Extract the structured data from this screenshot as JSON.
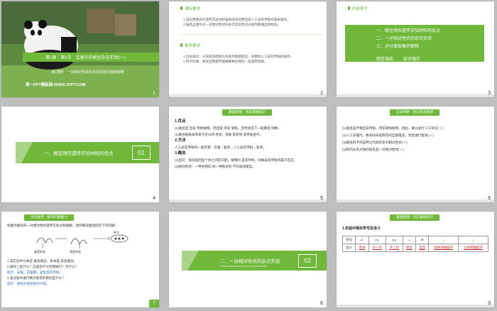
{
  "slides": [
    {
      "num": "1",
      "title": "第1章　第1节　孟德尔的豌豆杂交实验(一)",
      "subtitle": "第1课时　一对相对性状的杂交实验过程和解释",
      "footer": "第一PPT模板网-WWW.1PPT.COM"
    },
    {
      "num": "2",
      "section1": "课标要求",
      "items1": [
        "1.说出用豌豆作遗传实验材料容易成功的原因及人工异花传粉的基本操作。",
        "2.描述孟德尔对一对相对性状的杂交实验及对分离现象做出的假说。"
      ],
      "section2": "素养要求",
      "items2": [
        "1.生命观念：认知花的结构与生殖功能相适应，并模拟人工异花传粉的操作。",
        "2.科学思维：尝试运用遗传图解解释生物的一些遗传现象。"
      ]
    },
    {
      "num": "3",
      "header": "内容索引",
      "menu": [
        "一、豌豆用作遗传实验材料的优点",
        "二、一对相对性状的杂交实验",
        "三、对分离现象的解释"
      ],
      "extra": [
        "随堂演练",
        "知识落实"
      ]
    },
    {
      "num": "4",
      "title": "一、豌豆用作遗传实验材料的优点",
      "badge": "01"
    },
    {
      "num": "5",
      "tag": "基础梳理 · 夯实基础知识",
      "lines": [
        "1.优点",
        "(1)豌豆是 自花 传粉植物，而且是 闭花 受粉。自然状态下一般都是 纯种。",
        "(2)豌豆植株具有易于区分的 性状，且能 稳定地 遗传给后代。",
        "2.方法",
        "人工异花传粉的一般步骤：去雄→套袋→人工异花传粉→套袋。",
        "3.概念",
        "(1)自交：指同基因型个体之间的交配，植物的 自花传粉，同株异花传粉均属于自交。",
        "(2)相对性状：一种生物的 同一种性状的 不同表现类型。"
      ]
    },
    {
      "num": "6",
      "tag": "正误判断 · 矫正易混易错",
      "lines": [
        "(1)豌豆是严格自花传粉、闭花受粉植物，因此，难以进行人工杂交( × )",
        "(2)人工去雄时，要去除未成熟花的全部雄蕊，然后进行套袋( √ )",
        "(3)豌豆的不同品种之间具有多对相对性状( √ )",
        "(4)狗的长毛对兔的短毛是一对相对性状( × )"
      ]
    },
    {
      "num": "7",
      "tag": "深化探究 · 解决问题能力",
      "intro": "如图为豌豆的一对相对性状遗传实验过程图解，请仔细读图后回答下列问题：",
      "labels": [
        "矮茎的花",
        "高茎的花",
        "种子"
      ],
      "qa": [
        "1.该实验中父本是 矮茎豌豆，母本是 高茎豌豆。",
        "2.操作①是什么？应该在什么时期进行？为什么？",
        "提示　去雄，花蕾期；避免自花传粉。",
        "3.该过程中进行两次套袋的目的是什么？",
        "提示　避免外来花粉的干扰。"
      ]
    },
    {
      "num": "8",
      "title": "二、一对相对性状的杂交实验",
      "badge": "02",
      "sub": "Cross experiment of a pair of relative traits"
    },
    {
      "num": "9",
      "tag": "基础梳理 · 夯实基础知识",
      "heading": "1.实验中相关符号及含义",
      "headers": [
        "符号",
        "P",
        "F1",
        "F2",
        "×",
        "⊗",
        "♀",
        "♂"
      ],
      "row_label": "含义",
      "cells": [
        "亲本",
        "子一代",
        "子二代",
        "杂交",
        "自交",
        "母本或雌配子",
        "父本或雄配子"
      ]
    }
  ]
}
